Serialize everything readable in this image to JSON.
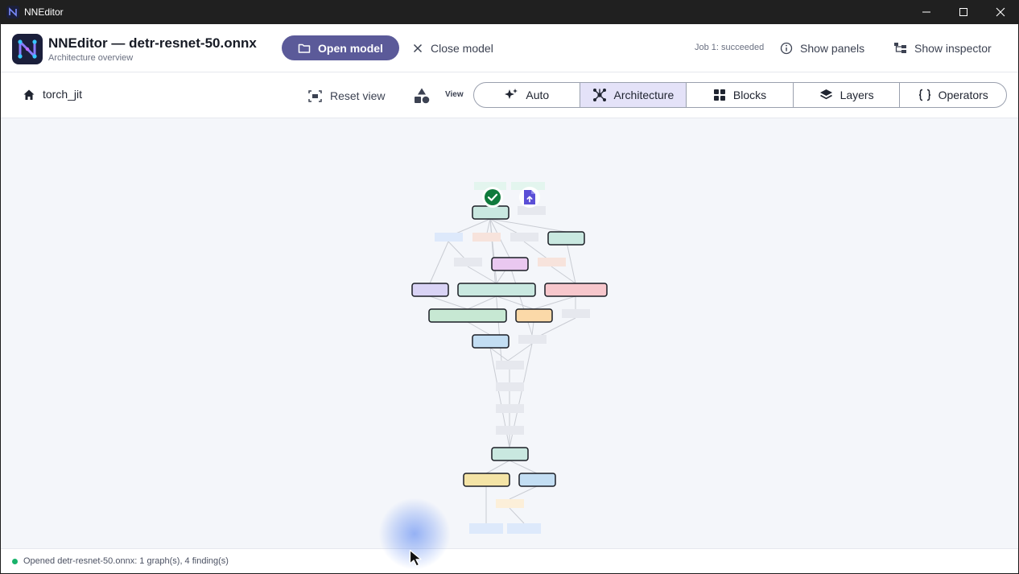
{
  "window": {
    "title": "NNEditor"
  },
  "header": {
    "app_title": "NNEditor — detr-resnet-50.onnx",
    "subtitle": "Architecture overview",
    "open_model_label": "Open model",
    "close_model_label": "Close model",
    "job_status": "Job 1: succeeded",
    "show_panels_label": "Show panels",
    "show_inspector_label": "Show inspector"
  },
  "toolbar": {
    "breadcrumb": "torch_jit",
    "reset_view_label": "Reset view",
    "view_label": "View",
    "view_modes": [
      {
        "label": "Auto",
        "icon": "sparkle-icon",
        "active": false
      },
      {
        "label": "Architecture",
        "icon": "network-icon",
        "active": true
      },
      {
        "label": "Blocks",
        "icon": "grid-icon",
        "active": false
      },
      {
        "label": "Layers",
        "icon": "layers-icon",
        "active": false
      },
      {
        "label": "Operators",
        "icon": "braces-icon",
        "active": false
      }
    ]
  },
  "graph": {
    "badges": [
      {
        "icon": "check-circle-icon",
        "color": "#0f7a3c"
      },
      {
        "icon": "file-upload-icon",
        "color": "#5b4fd6"
      }
    ],
    "node_colors": {
      "teal": "#c9e8e0",
      "purple": "#d9d3f5",
      "pink": "#eac8f0",
      "red": "#f7c7cc",
      "green": "#c7e8d3",
      "orange": "#fbd9a8",
      "blue": "#c3def3",
      "yellow": "#f4e4a6"
    }
  },
  "status": {
    "dot_color": "#19b26b",
    "text": "Opened detr-resnet-50.onnx: 1 graph(s), 4 finding(s)"
  }
}
